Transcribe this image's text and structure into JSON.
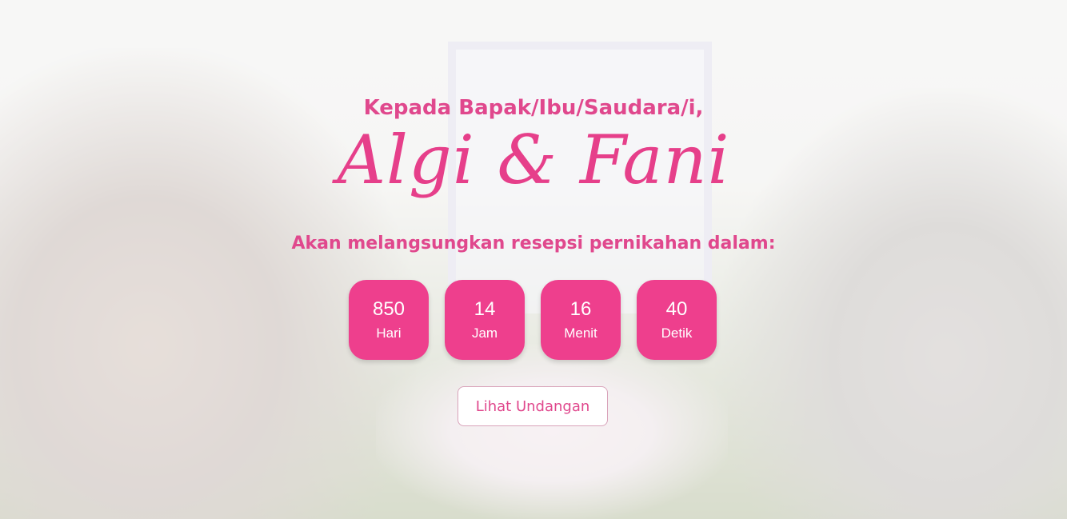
{
  "hero": {
    "greeting": "Kepada Bapak/Ibu/Saudara/i,",
    "couple_names": "Algi & Fani",
    "subtitle": "Akan melangsungkan resepsi pernikahan dalam:"
  },
  "countdown": {
    "days": {
      "value": "850",
      "label": "Hari"
    },
    "hours": {
      "value": "14",
      "label": "Jam"
    },
    "minutes": {
      "value": "16",
      "label": "Menit"
    },
    "seconds": {
      "value": "40",
      "label": "Detik"
    }
  },
  "cta": {
    "label": "Lihat Undangan"
  },
  "colors": {
    "accent": "#ee3f8d",
    "text_pink": "#e0488d",
    "button_bg": "#ffffff"
  }
}
